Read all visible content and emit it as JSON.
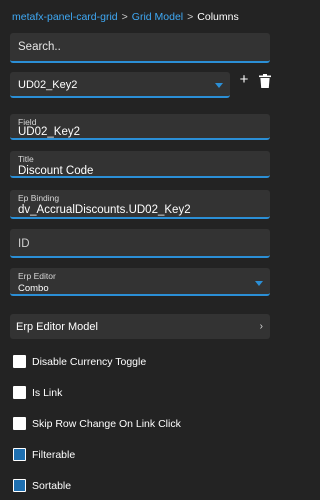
{
  "breadcrumb": {
    "items": [
      "metafx-panel-card-grid",
      "Grid Model"
    ],
    "separator": ">",
    "current": "Columns"
  },
  "search": {
    "placeholder": "Search.."
  },
  "column_select": {
    "value": "UD02_Key2"
  },
  "fields": [
    {
      "label": "Field",
      "value": "UD02_Key2"
    },
    {
      "label": "Title",
      "value": "Discount Code"
    },
    {
      "label": "Ep Binding",
      "value": "dv_AccrualDiscounts.UD02_Key2"
    },
    {
      "label": "",
      "value": "ID"
    },
    {
      "label": "Erp Editor",
      "value": "Combo"
    }
  ],
  "editor_model": {
    "label": "Erp Editor Model"
  },
  "checkboxes": [
    {
      "label": "Disable Currency Toggle",
      "checked": false
    },
    {
      "label": "Is Link",
      "checked": false
    },
    {
      "label": "Skip Row Change On Link Click",
      "checked": false
    },
    {
      "label": "Filterable",
      "checked": true
    },
    {
      "label": "Sortable",
      "checked": true
    }
  ],
  "colors": {
    "background": "#232323",
    "field_bg": "#333333",
    "accent": "#2b8fd6",
    "link": "#3fa9f5",
    "checked": "#1e6fb0"
  },
  "icons": [
    "plus-icon",
    "trash-icon",
    "chevron-down-icon",
    "chevron-right-icon"
  ]
}
